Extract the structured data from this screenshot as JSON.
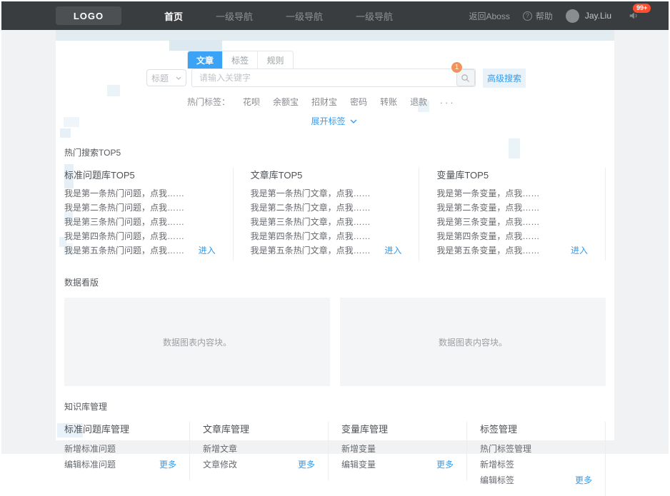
{
  "navbar": {
    "logo": "LOGO",
    "items": [
      {
        "label": "首页"
      },
      {
        "label": "一级导航"
      },
      {
        "label": "一级导航"
      },
      {
        "label": "一级导航"
      }
    ],
    "right": {
      "back_link": "返回Aboss",
      "help_label": "帮助",
      "username": "Jay.Liu",
      "notification_badge": "99+"
    }
  },
  "search": {
    "tabs": [
      {
        "label": "文章"
      },
      {
        "label": "标签"
      },
      {
        "label": "规则"
      }
    ],
    "field_select_value": "标题",
    "input_placeholder": "请输入关键字",
    "search_button_badge": "1",
    "advanced_link": "高级搜索",
    "hot_tags_label": "热门标签：",
    "hot_tags": [
      "花呗",
      "余额宝",
      "招财宝",
      "密码",
      "转账",
      "退款"
    ],
    "hot_tags_more": "...",
    "expand_label": "展开标签"
  },
  "hot_search": {
    "title": "热门搜索TOP5",
    "enter_label": "进入",
    "columns": [
      {
        "title": "标准问题库TOP5",
        "items": [
          "我是第一条热门问题，点我……",
          "我是第二条热门问题，点我……",
          "我是第三条热门问题，点我……",
          "我是第四条热门问题，点我……",
          "我是第五条热门问题，点我……"
        ],
        "link": "进入"
      },
      {
        "title": "文章库TOP5",
        "items": [
          "我是第一条热门文章，点我……",
          "我是第二条热门文章，点我……",
          "我是第三条热门文章，点我……",
          "我是第四条热门文章，点我……",
          "我是第五条热门文章，点我……"
        ],
        "link": "进入"
      },
      {
        "title": "变量库TOP5",
        "items": [
          "我是第一条变量，点我……",
          "我是第二条变量，点我……",
          "我是第三条变量，点我……",
          "我是第四条变量，点我……",
          "我是第五条变量，点我……"
        ],
        "link": "进入"
      }
    ]
  },
  "dashboard": {
    "title": "数据看版",
    "blocks": [
      {
        "placeholder": "数据图表内容块。"
      },
      {
        "placeholder": "数据图表内容块。"
      }
    ]
  },
  "knowledge": {
    "title": "知识库管理",
    "columns": [
      {
        "title": "标准问题库管理",
        "items": [
          "新增标准问题",
          "编辑标准问题"
        ],
        "link": "更多"
      },
      {
        "title": "文章库管理",
        "items": [
          "新增文章",
          "文章修改"
        ],
        "link": "更多"
      },
      {
        "title": "变量库管理",
        "items": [
          "新增变量",
          "编辑变量"
        ],
        "link": "更多"
      },
      {
        "title": "标签管理",
        "items": [
          "热门标签管理",
          "新增标签",
          "编辑标签"
        ],
        "link": "更多"
      }
    ]
  },
  "colors": {
    "accent_blue": "#3ba3f6",
    "link_blue": "#2f9cf5",
    "badge_orange": "#f2925d",
    "badge_red": "#ff4f31",
    "navbar_bg": "#3a3d40"
  }
}
